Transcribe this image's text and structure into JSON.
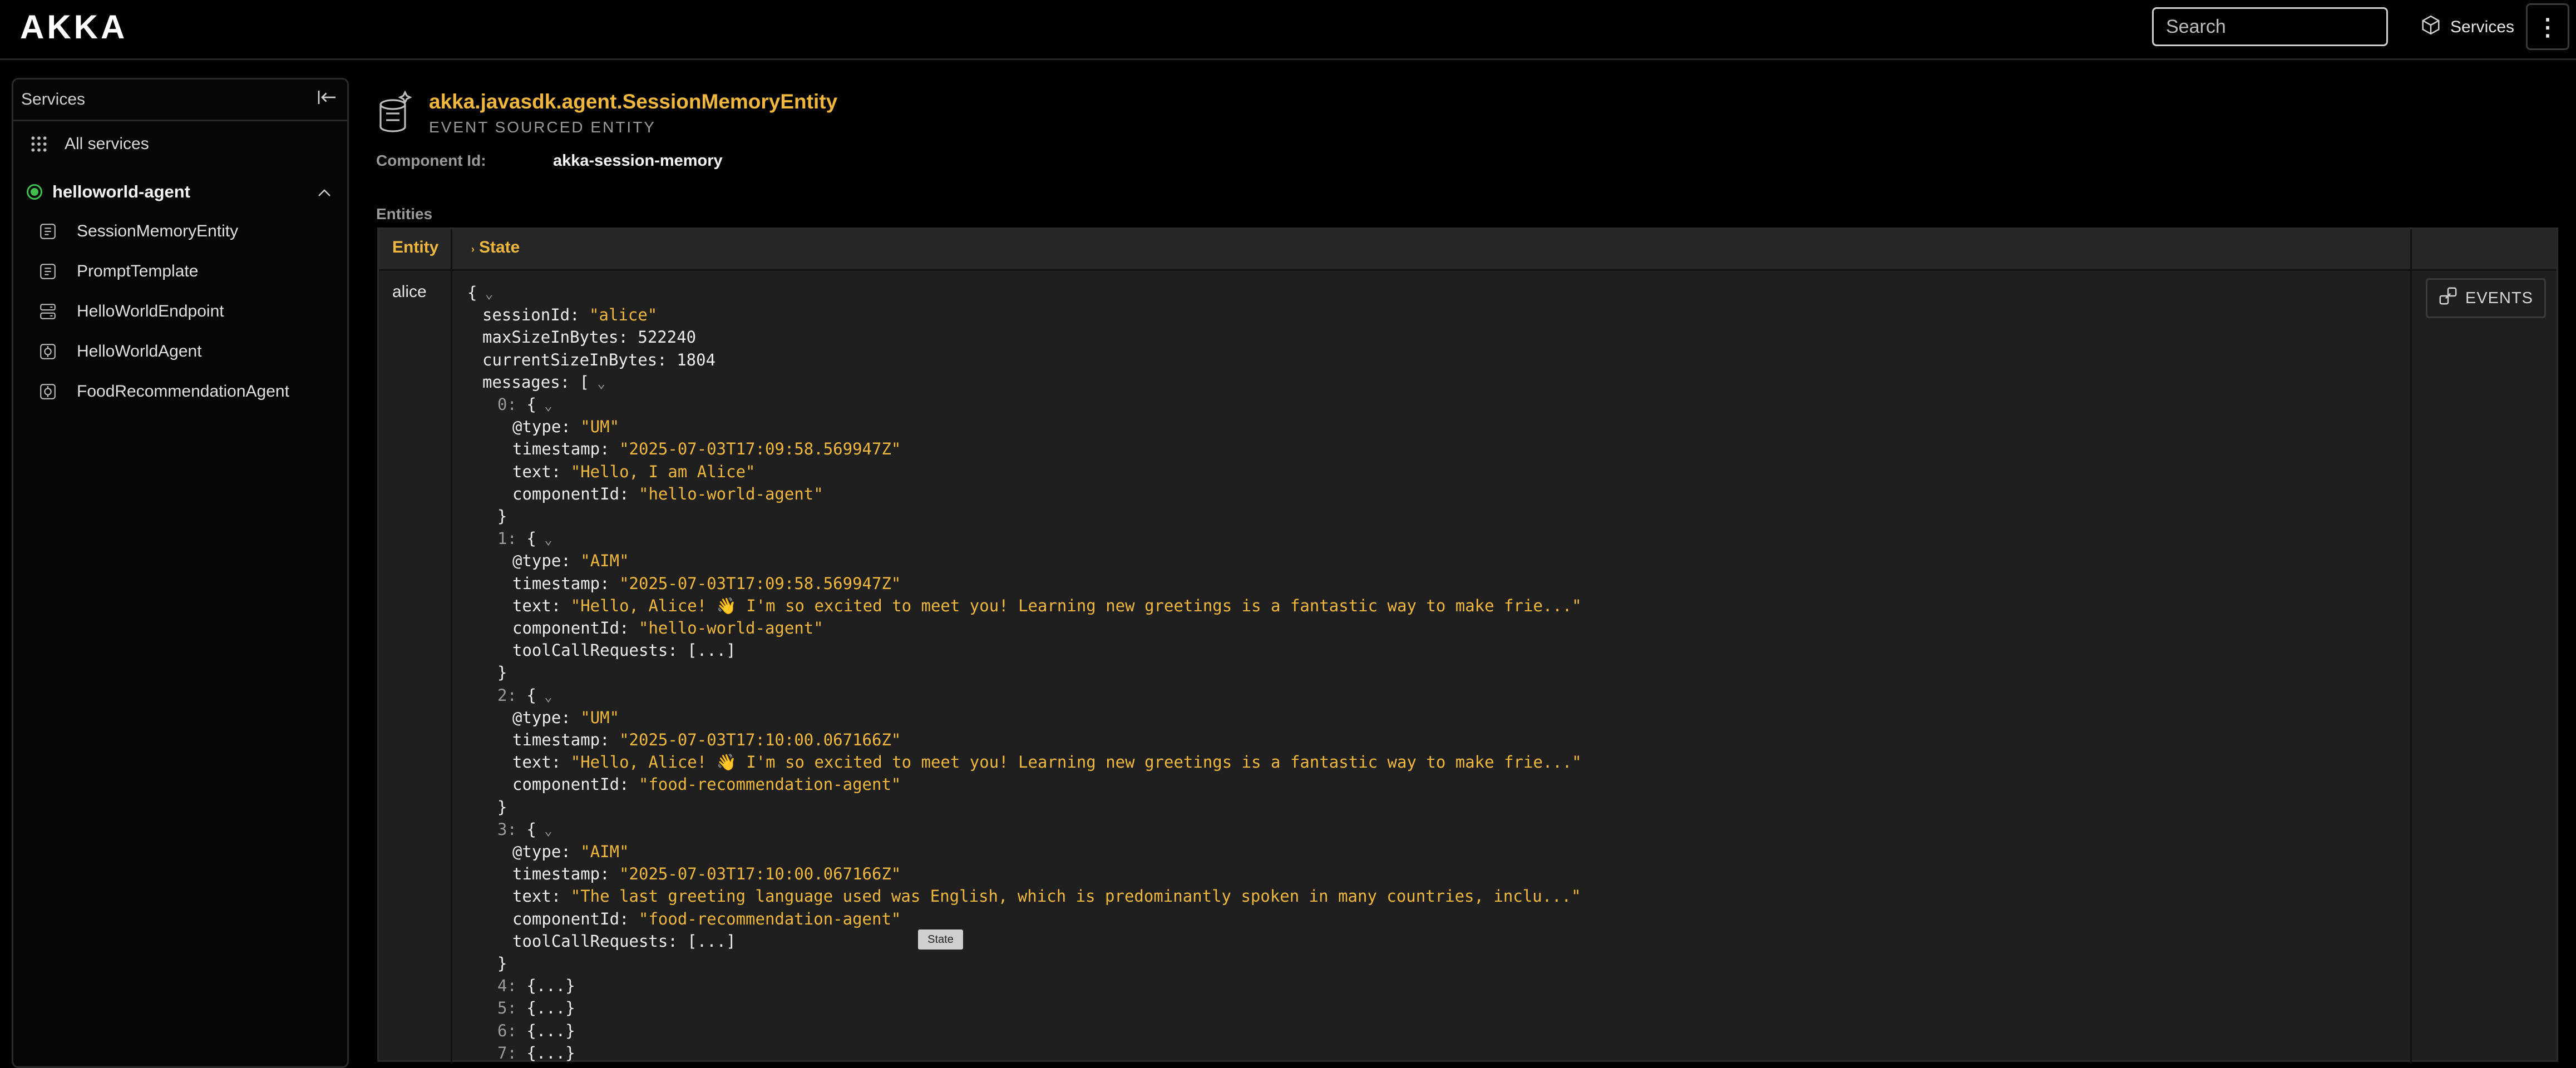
{
  "app": {
    "logo": "AKKA"
  },
  "topbar": {
    "search_placeholder": "Search",
    "services_label": "Services",
    "menu_glyph": "⋮"
  },
  "sidebar": {
    "title": "Services",
    "all_services": "All services",
    "group": {
      "name": "helloworld-agent",
      "status_color": "#3fbf4d"
    },
    "items": [
      {
        "label": "SessionMemoryEntity",
        "icon": "event-sourced-entity-icon"
      },
      {
        "label": "PromptTemplate",
        "icon": "event-sourced-entity-icon"
      },
      {
        "label": "HelloWorldEndpoint",
        "icon": "endpoint-icon"
      },
      {
        "label": "HelloWorldAgent",
        "icon": "agent-icon"
      },
      {
        "label": "FoodRecommendationAgent",
        "icon": "agent-icon"
      }
    ]
  },
  "component": {
    "name": "akka.javasdk.agent.SessionMemoryEntity",
    "kind": "EVENT SOURCED ENTITY",
    "id_label": "Component Id:",
    "id_value": "akka-session-memory"
  },
  "entities": {
    "section_label": "Entities",
    "col_entity": "Entity",
    "col_state": "State",
    "row_entity": "alice",
    "events_label": "EVENTS",
    "tooltip": "State"
  },
  "state_lines": [
    {
      "i": 0,
      "c": "{",
      "chev": true
    },
    {
      "i": 1,
      "k": "sessionId",
      "v": "\"alice\"",
      "t": "s"
    },
    {
      "i": 1,
      "k": "maxSizeInBytes",
      "v": "522240",
      "t": "n"
    },
    {
      "i": 1,
      "k": "currentSizeInBytes",
      "v": "1804",
      "t": "n"
    },
    {
      "i": 1,
      "k": "messages",
      "v": "[",
      "t": "n",
      "chev": true
    },
    {
      "i": 2,
      "k": "0",
      "v": "{",
      "t": "n",
      "chev": true,
      "idx": true
    },
    {
      "i": 3,
      "k": "@type",
      "v": "\"UM\"",
      "t": "s"
    },
    {
      "i": 3,
      "k": "timestamp",
      "v": "\"2025-07-03T17:09:58.569947Z\"",
      "t": "s"
    },
    {
      "i": 3,
      "k": "text",
      "v": "\"Hello, I am Alice\"",
      "t": "s"
    },
    {
      "i": 3,
      "k": "componentId",
      "v": "\"hello-world-agent\"",
      "t": "s"
    },
    {
      "i": 2,
      "c": "}"
    },
    {
      "i": 2,
      "k": "1",
      "v": "{",
      "t": "n",
      "chev": true,
      "idx": true
    },
    {
      "i": 3,
      "k": "@type",
      "v": "\"AIM\"",
      "t": "s"
    },
    {
      "i": 3,
      "k": "timestamp",
      "v": "\"2025-07-03T17:09:58.569947Z\"",
      "t": "s"
    },
    {
      "i": 3,
      "k": "text",
      "v": "\"Hello, Alice! 👋 I'm so excited to meet you! Learning new greetings is a fantastic way to make frie...\"",
      "t": "s"
    },
    {
      "i": 3,
      "k": "componentId",
      "v": "\"hello-world-agent\"",
      "t": "s"
    },
    {
      "i": 3,
      "k": "toolCallRequests",
      "v": "[...]",
      "t": "n"
    },
    {
      "i": 2,
      "c": "}"
    },
    {
      "i": 2,
      "k": "2",
      "v": "{",
      "t": "n",
      "chev": true,
      "idx": true
    },
    {
      "i": 3,
      "k": "@type",
      "v": "\"UM\"",
      "t": "s"
    },
    {
      "i": 3,
      "k": "timestamp",
      "v": "\"2025-07-03T17:10:00.067166Z\"",
      "t": "s"
    },
    {
      "i": 3,
      "k": "text",
      "v": "\"Hello, Alice! 👋 I'm so excited to meet you! Learning new greetings is a fantastic way to make frie...\"",
      "t": "s"
    },
    {
      "i": 3,
      "k": "componentId",
      "v": "\"food-recommendation-agent\"",
      "t": "s"
    },
    {
      "i": 2,
      "c": "}"
    },
    {
      "i": 2,
      "k": "3",
      "v": "{",
      "t": "n",
      "chev": true,
      "idx": true
    },
    {
      "i": 3,
      "k": "@type",
      "v": "\"AIM\"",
      "t": "s"
    },
    {
      "i": 3,
      "k": "timestamp",
      "v": "\"2025-07-03T17:10:00.067166Z\"",
      "t": "s"
    },
    {
      "i": 3,
      "k": "text",
      "v": "\"The last greeting language used was English, which is predominantly spoken in many countries, inclu...\"",
      "t": "s"
    },
    {
      "i": 3,
      "k": "componentId",
      "v": "\"food-recommendation-agent\"",
      "t": "s"
    },
    {
      "i": 3,
      "k": "toolCallRequests",
      "v": "[...]",
      "t": "n"
    },
    {
      "i": 2,
      "c": "}"
    },
    {
      "i": 2,
      "k": "4",
      "v": "{...}",
      "t": "n",
      "idx": true
    },
    {
      "i": 2,
      "k": "5",
      "v": "{...}",
      "t": "n",
      "idx": true
    },
    {
      "i": 2,
      "k": "6",
      "v": "{...}",
      "t": "n",
      "idx": true
    },
    {
      "i": 2,
      "k": "7",
      "v": "{...}",
      "t": "n",
      "idx": true
    }
  ]
}
